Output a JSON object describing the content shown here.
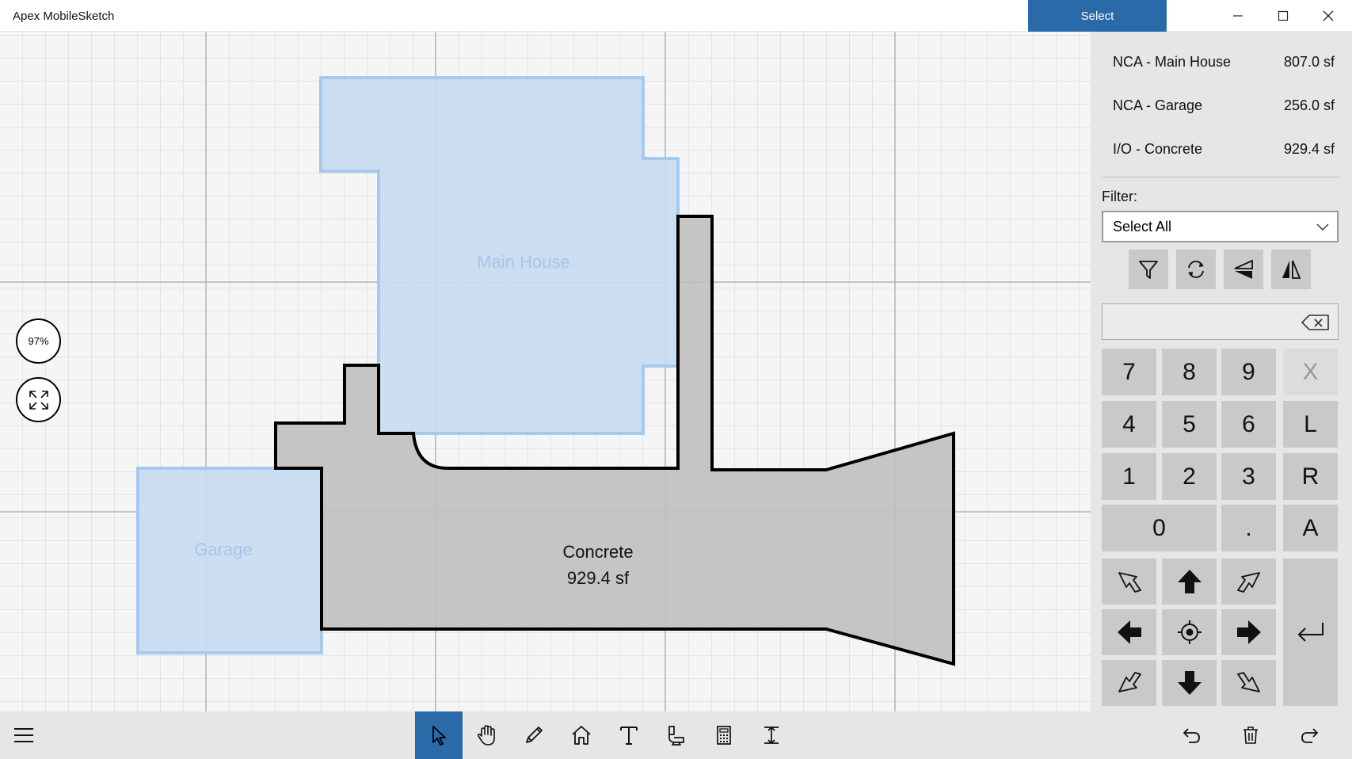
{
  "app": {
    "title": "Apex MobileSketch",
    "mode_label": "Select"
  },
  "window_controls": [
    "minimize-icon",
    "maximize-icon",
    "close-icon"
  ],
  "canvas": {
    "zoom_label": "97%",
    "shapes": [
      {
        "name": "Main House",
        "style": "selected-blue"
      },
      {
        "name": "Garage",
        "style": "selected-blue"
      },
      {
        "name": "Concrete",
        "area": "929.4 sf",
        "style": "gray"
      }
    ]
  },
  "areas": [
    {
      "name": "NCA - Main House",
      "value": "807.0 sf"
    },
    {
      "name": "NCA - Garage",
      "value": "256.0 sf"
    },
    {
      "name": "I/O - Concrete",
      "value": "929.4 sf"
    }
  ],
  "filter": {
    "label": "Filter:",
    "selected": "Select All"
  },
  "tool_buttons": [
    "filter-icon",
    "refresh-icon",
    "flip-vertical-icon",
    "flip-horizontal-icon"
  ],
  "keypad": {
    "keys": [
      "7",
      "8",
      "9",
      "X",
      "4",
      "5",
      "6",
      "L",
      "1",
      "2",
      "3",
      "R",
      "0",
      ".",
      "A"
    ]
  },
  "toolbar": {
    "left": "menu-icon",
    "center": [
      "select-pointer-icon",
      "pan-hand-icon",
      "pencil-icon",
      "home-icon",
      "text-icon",
      "fixture-icon",
      "calculator-icon",
      "dimension-icon"
    ],
    "right": [
      "undo-icon",
      "delete-icon",
      "redo-icon"
    ]
  },
  "colors": {
    "accent": "#2a6aa8",
    "selected_fill": "#c8dcf2",
    "selected_stroke": "#a6c9ee",
    "concrete_fill": "#c0c0c0",
    "panel_bg": "#e6e6e6"
  }
}
